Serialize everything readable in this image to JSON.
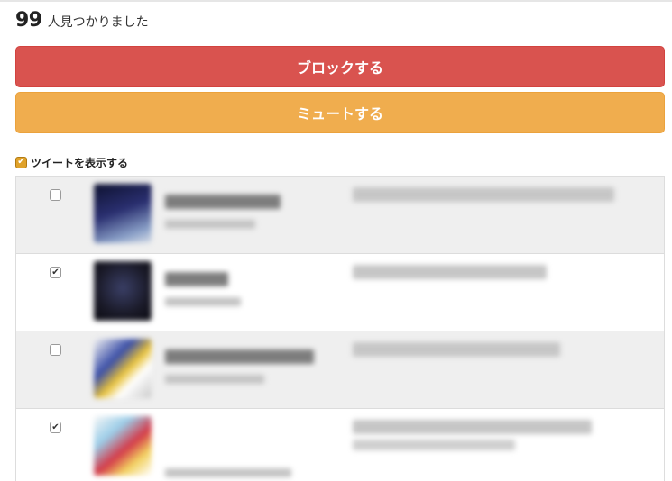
{
  "header": {
    "count": "99",
    "found_text": "人見つかりました"
  },
  "actions": {
    "block_label": "ブロックする",
    "mute_label": "ミュートする"
  },
  "show_tweets": {
    "label": "ツイートを表示する",
    "checked": true
  },
  "users": [
    {
      "selected": false
    },
    {
      "selected": true
    },
    {
      "selected": false
    },
    {
      "selected": true
    }
  ],
  "colors": {
    "block_button": "#d9534f",
    "mute_button": "#f0ad4e",
    "row_alt_bg": "#efefef"
  },
  "icons": {
    "checked": "✔"
  }
}
